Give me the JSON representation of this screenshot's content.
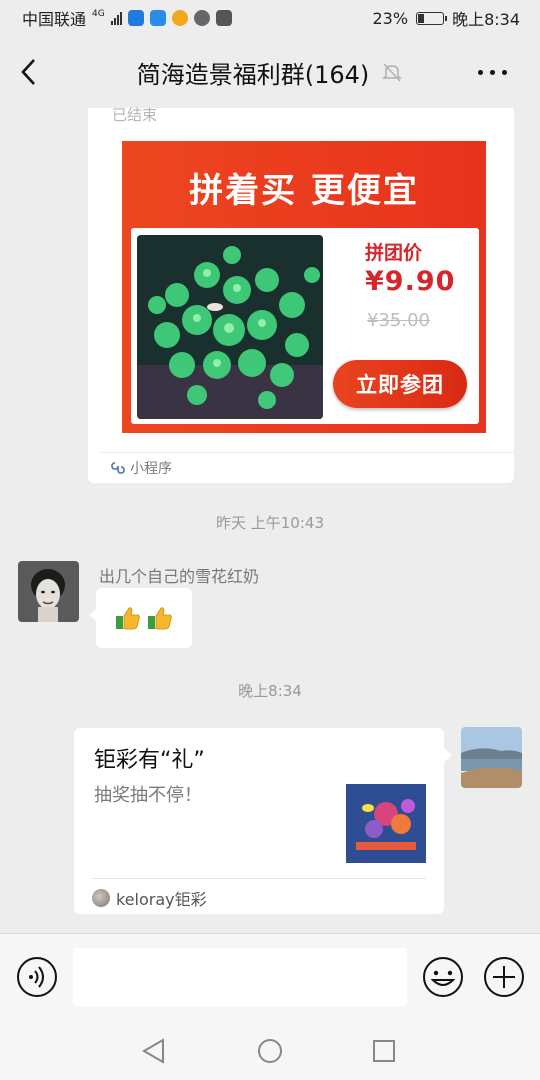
{
  "status_bar": {
    "carrier": "中国联通",
    "network": "4G",
    "battery": "23%",
    "time": "晚上8:34"
  },
  "header": {
    "title": "简海造景福利群(164)",
    "back_icon": "chevron-left-icon",
    "mute_icon": "bell-off-icon",
    "more_icon": "more-dots-icon"
  },
  "messages": {
    "promo_card": {
      "status": "已结束",
      "headline": "拼着买 更便宜",
      "price_label": "拼团价",
      "price": "¥9.90",
      "original_price": "¥35.00",
      "cta": "立即参团",
      "footer": "小程序"
    },
    "timestamp_1": "昨天 上午10:43",
    "incoming": {
      "sender": "出几个自己的雪花红奶",
      "emoji": "thumbs-up-icon"
    },
    "timestamp_2": "晚上8:34",
    "outgoing_link": {
      "title": "钜彩有“礼”",
      "description": "抽奖抽不停！",
      "source": "keloray钜彩"
    }
  },
  "input_bar": {
    "voice_icon": "voice-icon",
    "emoji_icon": "emoji-icon",
    "plus_icon": "plus-icon"
  },
  "nav": {
    "back": "triangle-back-icon",
    "home": "circle-home-icon",
    "recent": "square-recent-icon"
  },
  "colors": {
    "promo_red": "#e8321c",
    "price_red": "#d7252c",
    "background": "#ededed"
  }
}
